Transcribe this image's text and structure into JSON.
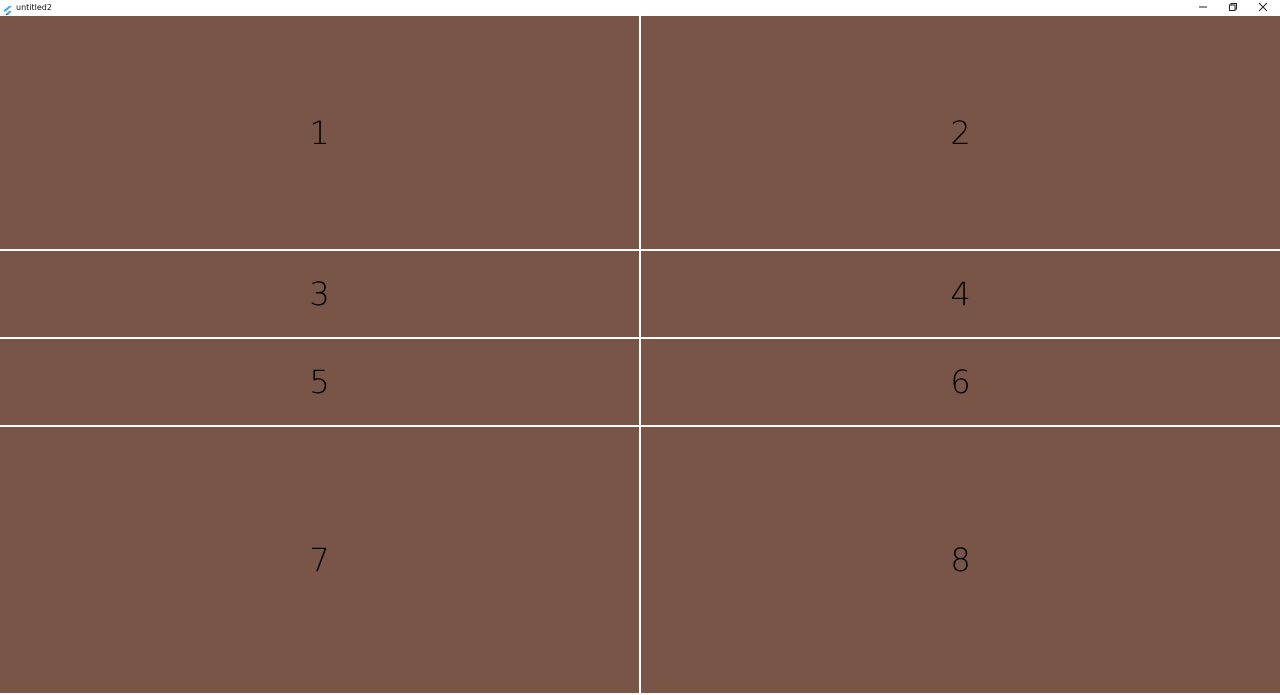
{
  "window": {
    "title": "untitled2",
    "app_icon": "flutter-logo-icon",
    "controls": [
      "minimize-icon",
      "restore-icon",
      "close-icon"
    ]
  },
  "grid": {
    "cell_color": "#795548",
    "divider_color": "#ffffff",
    "cells": [
      {
        "label": "1"
      },
      {
        "label": "2"
      },
      {
        "label": "3"
      },
      {
        "label": "4"
      },
      {
        "label": "5"
      },
      {
        "label": "6"
      },
      {
        "label": "7"
      },
      {
        "label": "8"
      }
    ]
  }
}
